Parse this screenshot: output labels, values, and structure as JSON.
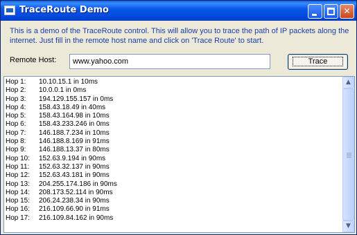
{
  "window": {
    "title": "TraceRoute Demo",
    "controls": {
      "minimize": "minimize",
      "maximize": "maximize",
      "close": "✕"
    }
  },
  "description": "This is a demo of the TraceRoute control.  This will allow you to trace the path of IP packets along the internet.  Just fill in the remote host name and click on 'Trace Route' to start.",
  "form": {
    "remote_host_label": "Remote Host:",
    "remote_host_value": "www.yahoo.com",
    "trace_button_label": "Trace"
  },
  "results": [
    {
      "hop": "Hop 1:",
      "text": "10.10.15.1 in 10ms"
    },
    {
      "hop": "Hop 2:",
      "text": "10.0.0.1 in 0ms"
    },
    {
      "hop": "Hop 3:",
      "text": "194.129.155.157 in 0ms"
    },
    {
      "hop": "Hop 4:",
      "text": "158.43.18.49 in 40ms"
    },
    {
      "hop": "Hop 5:",
      "text": "158.43.164.98 in 10ms"
    },
    {
      "hop": "Hop 6:",
      "text": "158.43.233.246 in 0ms"
    },
    {
      "hop": "Hop 7:",
      "text": "146.188.7.234 in 10ms"
    },
    {
      "hop": "Hop 8:",
      "text": "146.188.8.169 in 91ms"
    },
    {
      "hop": "Hop 9:",
      "text": "146.188.13.37 in 80ms"
    },
    {
      "hop": "Hop 10:",
      "text": "152.63.9.194 in 90ms"
    },
    {
      "hop": "Hop 11:",
      "text": "152.63.32.137 in 90ms"
    },
    {
      "hop": "Hop 12:",
      "text": "152.63.43.181 in 90ms"
    },
    {
      "hop": "Hop 13:",
      "text": "204.255.174.186 in 90ms"
    },
    {
      "hop": "Hop 14:",
      "text": "208.173.52.114 in 90ms"
    },
    {
      "hop": "Hop 15:",
      "text": "206.24.238.34 in 90ms"
    },
    {
      "hop": "Hop 16:",
      "text": "216.109.66.90 in 91ms"
    },
    {
      "hop": "Hop 17:",
      "text": "216.109.84.162 in 90ms"
    }
  ],
  "scrollbar": {
    "up_arrow": "▲",
    "down_arrow": "▼"
  },
  "colors": {
    "description_text": "#1c3da6",
    "titlebar": "#0348dd"
  }
}
